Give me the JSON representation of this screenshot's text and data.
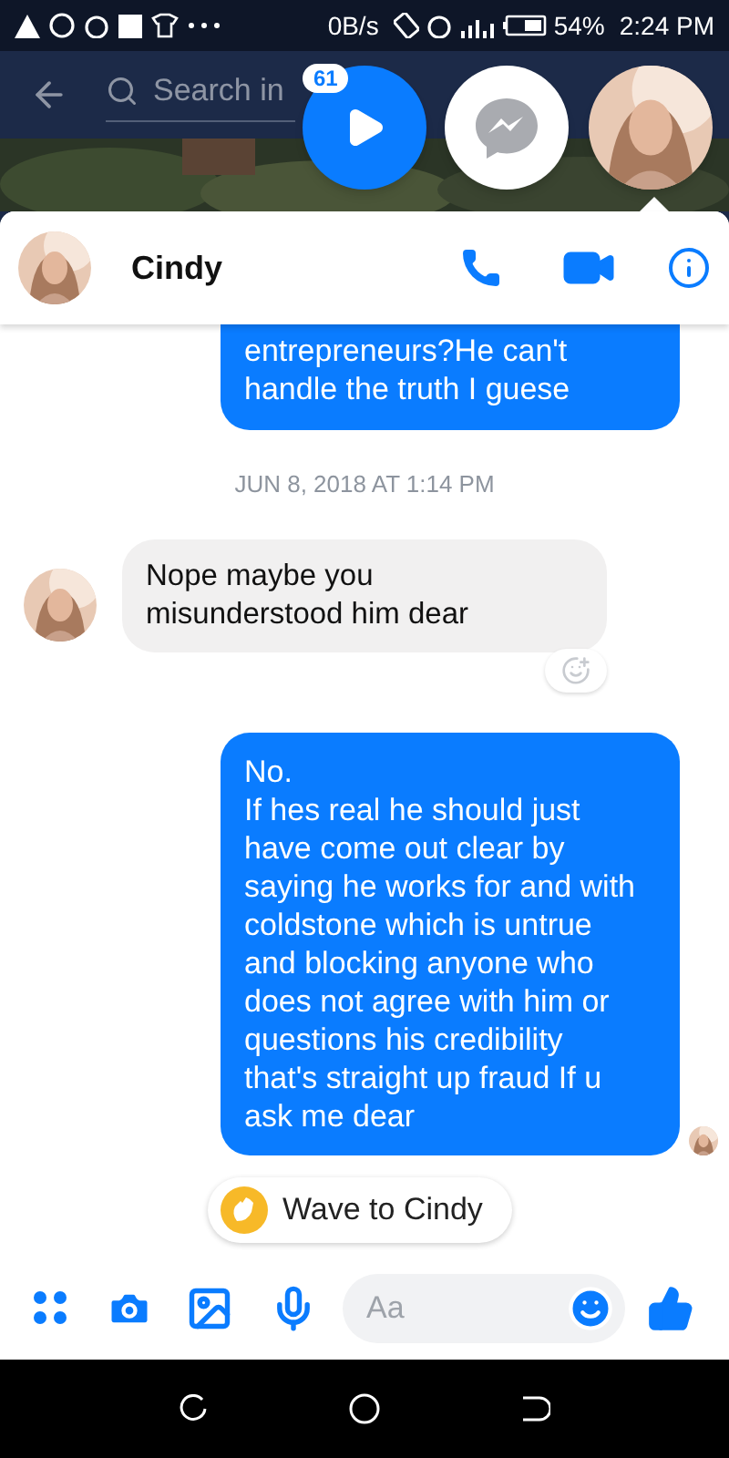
{
  "status_bar": {
    "speed": "0B/s",
    "battery": "54%",
    "time": "2:24 PM"
  },
  "background": {
    "search": {
      "placeholder": "Search in"
    }
  },
  "chat_heads": {
    "badge": "61"
  },
  "conversation": {
    "contact": "Cindy",
    "messages": [
      {
        "kind": "outgoing",
        "text": "entrepreneurs?He can't\nhandle the truth I guese",
        "cut_top": true
      },
      {
        "kind": "timestamp",
        "text": "JUN 8, 2018 AT 1:14 PM"
      },
      {
        "kind": "incoming",
        "text": "Nope maybe you\nmisunderstood him dear"
      },
      {
        "kind": "outgoing",
        "text": "No.\nIf hes real he should just have come out clear by saying he works for and with coldstone which is untrue and blocking anyone who does not agree with him or questions his credibility that's straight up fraud If u ask me dear",
        "seen": true
      }
    ],
    "wave": "Wave to Cindy",
    "composer": {
      "placeholder": "Aa"
    }
  }
}
